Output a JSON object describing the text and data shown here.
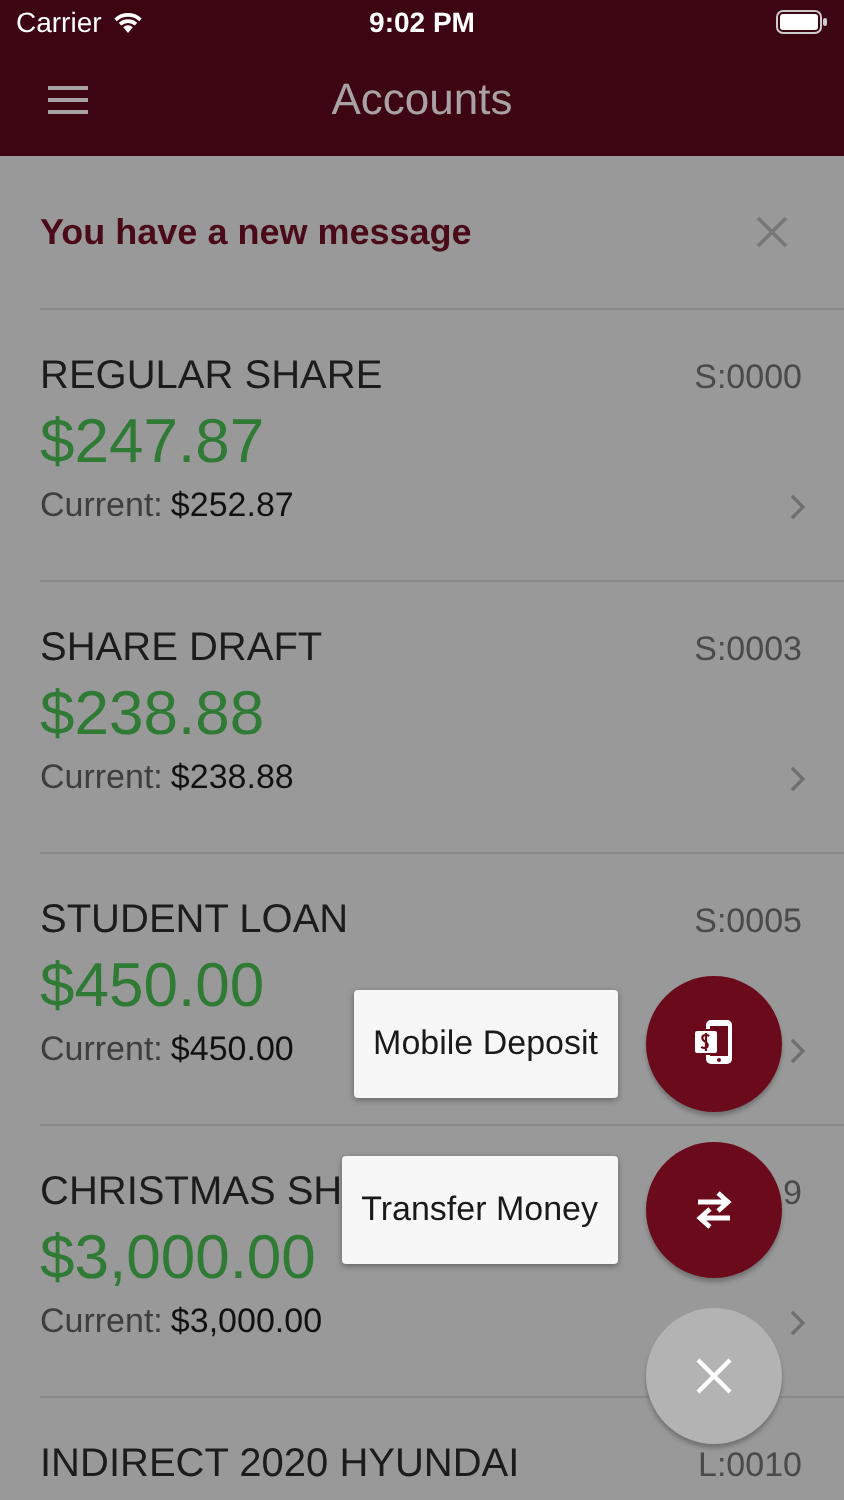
{
  "status_bar": {
    "carrier": "Carrier",
    "time": "9:02 PM"
  },
  "header": {
    "title": "Accounts"
  },
  "message": {
    "text": "You have a new message"
  },
  "accounts": [
    {
      "name": "REGULAR SHARE",
      "code": "S:0000",
      "balance": "$247.87",
      "current_label": "Current:",
      "current": "$252.87"
    },
    {
      "name": "SHARE DRAFT",
      "code": "S:0003",
      "balance": "$238.88",
      "current_label": "Current:",
      "current": "$238.88"
    },
    {
      "name": "STUDENT LOAN",
      "code": "S:0005",
      "balance": "$450.00",
      "current_label": "Current:",
      "current": "$450.00"
    },
    {
      "name": "CHRISTMAS SH",
      "code": "9",
      "balance": "$3,000.00",
      "current_label": "Current:",
      "current": "$3,000.00"
    },
    {
      "name": "INDIRECT 2020 HYUNDAI",
      "code": "L:0010"
    }
  ],
  "fab_menu": [
    {
      "label": "Mobile Deposit",
      "kind": "deposit"
    },
    {
      "label": "Transfer Money",
      "kind": "transfer"
    }
  ]
}
